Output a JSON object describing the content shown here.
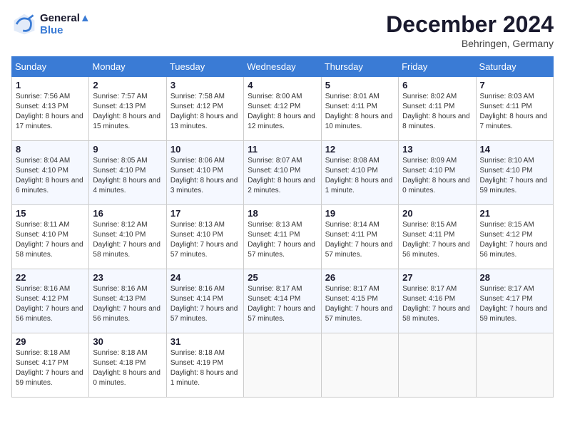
{
  "header": {
    "logo_line1": "General",
    "logo_line2": "Blue",
    "month": "December 2024",
    "location": "Behringen, Germany"
  },
  "columns": [
    "Sunday",
    "Monday",
    "Tuesday",
    "Wednesday",
    "Thursday",
    "Friday",
    "Saturday"
  ],
  "weeks": [
    [
      {
        "day": "1",
        "sunrise": "Sunrise: 7:56 AM",
        "sunset": "Sunset: 4:13 PM",
        "daylight": "Daylight: 8 hours and 17 minutes."
      },
      {
        "day": "2",
        "sunrise": "Sunrise: 7:57 AM",
        "sunset": "Sunset: 4:13 PM",
        "daylight": "Daylight: 8 hours and 15 minutes."
      },
      {
        "day": "3",
        "sunrise": "Sunrise: 7:58 AM",
        "sunset": "Sunset: 4:12 PM",
        "daylight": "Daylight: 8 hours and 13 minutes."
      },
      {
        "day": "4",
        "sunrise": "Sunrise: 8:00 AM",
        "sunset": "Sunset: 4:12 PM",
        "daylight": "Daylight: 8 hours and 12 minutes."
      },
      {
        "day": "5",
        "sunrise": "Sunrise: 8:01 AM",
        "sunset": "Sunset: 4:11 PM",
        "daylight": "Daylight: 8 hours and 10 minutes."
      },
      {
        "day": "6",
        "sunrise": "Sunrise: 8:02 AM",
        "sunset": "Sunset: 4:11 PM",
        "daylight": "Daylight: 8 hours and 8 minutes."
      },
      {
        "day": "7",
        "sunrise": "Sunrise: 8:03 AM",
        "sunset": "Sunset: 4:11 PM",
        "daylight": "Daylight: 8 hours and 7 minutes."
      }
    ],
    [
      {
        "day": "8",
        "sunrise": "Sunrise: 8:04 AM",
        "sunset": "Sunset: 4:10 PM",
        "daylight": "Daylight: 8 hours and 6 minutes."
      },
      {
        "day": "9",
        "sunrise": "Sunrise: 8:05 AM",
        "sunset": "Sunset: 4:10 PM",
        "daylight": "Daylight: 8 hours and 4 minutes."
      },
      {
        "day": "10",
        "sunrise": "Sunrise: 8:06 AM",
        "sunset": "Sunset: 4:10 PM",
        "daylight": "Daylight: 8 hours and 3 minutes."
      },
      {
        "day": "11",
        "sunrise": "Sunrise: 8:07 AM",
        "sunset": "Sunset: 4:10 PM",
        "daylight": "Daylight: 8 hours and 2 minutes."
      },
      {
        "day": "12",
        "sunrise": "Sunrise: 8:08 AM",
        "sunset": "Sunset: 4:10 PM",
        "daylight": "Daylight: 8 hours and 1 minute."
      },
      {
        "day": "13",
        "sunrise": "Sunrise: 8:09 AM",
        "sunset": "Sunset: 4:10 PM",
        "daylight": "Daylight: 8 hours and 0 minutes."
      },
      {
        "day": "14",
        "sunrise": "Sunrise: 8:10 AM",
        "sunset": "Sunset: 4:10 PM",
        "daylight": "Daylight: 7 hours and 59 minutes."
      }
    ],
    [
      {
        "day": "15",
        "sunrise": "Sunrise: 8:11 AM",
        "sunset": "Sunset: 4:10 PM",
        "daylight": "Daylight: 7 hours and 58 minutes."
      },
      {
        "day": "16",
        "sunrise": "Sunrise: 8:12 AM",
        "sunset": "Sunset: 4:10 PM",
        "daylight": "Daylight: 7 hours and 58 minutes."
      },
      {
        "day": "17",
        "sunrise": "Sunrise: 8:13 AM",
        "sunset": "Sunset: 4:10 PM",
        "daylight": "Daylight: 7 hours and 57 minutes."
      },
      {
        "day": "18",
        "sunrise": "Sunrise: 8:13 AM",
        "sunset": "Sunset: 4:11 PM",
        "daylight": "Daylight: 7 hours and 57 minutes."
      },
      {
        "day": "19",
        "sunrise": "Sunrise: 8:14 AM",
        "sunset": "Sunset: 4:11 PM",
        "daylight": "Daylight: 7 hours and 57 minutes."
      },
      {
        "day": "20",
        "sunrise": "Sunrise: 8:15 AM",
        "sunset": "Sunset: 4:11 PM",
        "daylight": "Daylight: 7 hours and 56 minutes."
      },
      {
        "day": "21",
        "sunrise": "Sunrise: 8:15 AM",
        "sunset": "Sunset: 4:12 PM",
        "daylight": "Daylight: 7 hours and 56 minutes."
      }
    ],
    [
      {
        "day": "22",
        "sunrise": "Sunrise: 8:16 AM",
        "sunset": "Sunset: 4:12 PM",
        "daylight": "Daylight: 7 hours and 56 minutes."
      },
      {
        "day": "23",
        "sunrise": "Sunrise: 8:16 AM",
        "sunset": "Sunset: 4:13 PM",
        "daylight": "Daylight: 7 hours and 56 minutes."
      },
      {
        "day": "24",
        "sunrise": "Sunrise: 8:16 AM",
        "sunset": "Sunset: 4:14 PM",
        "daylight": "Daylight: 7 hours and 57 minutes."
      },
      {
        "day": "25",
        "sunrise": "Sunrise: 8:17 AM",
        "sunset": "Sunset: 4:14 PM",
        "daylight": "Daylight: 7 hours and 57 minutes."
      },
      {
        "day": "26",
        "sunrise": "Sunrise: 8:17 AM",
        "sunset": "Sunset: 4:15 PM",
        "daylight": "Daylight: 7 hours and 57 minutes."
      },
      {
        "day": "27",
        "sunrise": "Sunrise: 8:17 AM",
        "sunset": "Sunset: 4:16 PM",
        "daylight": "Daylight: 7 hours and 58 minutes."
      },
      {
        "day": "28",
        "sunrise": "Sunrise: 8:17 AM",
        "sunset": "Sunset: 4:17 PM",
        "daylight": "Daylight: 7 hours and 59 minutes."
      }
    ],
    [
      {
        "day": "29",
        "sunrise": "Sunrise: 8:18 AM",
        "sunset": "Sunset: 4:17 PM",
        "daylight": "Daylight: 7 hours and 59 minutes."
      },
      {
        "day": "30",
        "sunrise": "Sunrise: 8:18 AM",
        "sunset": "Sunset: 4:18 PM",
        "daylight": "Daylight: 8 hours and 0 minutes."
      },
      {
        "day": "31",
        "sunrise": "Sunrise: 8:18 AM",
        "sunset": "Sunset: 4:19 PM",
        "daylight": "Daylight: 8 hours and 1 minute."
      },
      null,
      null,
      null,
      null
    ]
  ]
}
